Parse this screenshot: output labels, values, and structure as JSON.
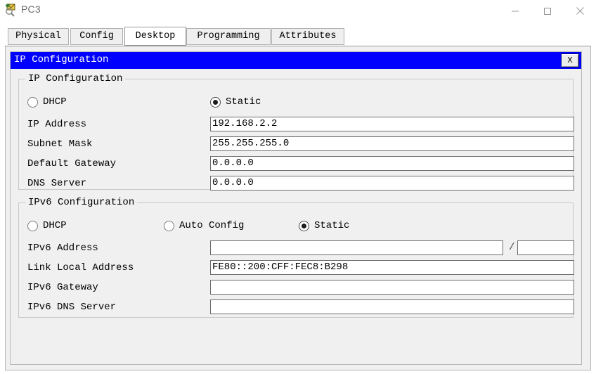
{
  "window": {
    "title": "PC3",
    "icon": "pc-magnifier-icon",
    "controls": {
      "minimize": "minimize-icon",
      "maximize": "maximize-icon",
      "close": "close-icon"
    }
  },
  "tabs": [
    {
      "label": "Physical",
      "active": false
    },
    {
      "label": "Config",
      "active": false
    },
    {
      "label": "Desktop",
      "active": true
    },
    {
      "label": "Programming",
      "active": false
    },
    {
      "label": "Attributes",
      "active": false
    }
  ],
  "internal_window": {
    "title": "IP Configuration",
    "close_label": "X"
  },
  "ipv4": {
    "legend": "IP Configuration",
    "mode_options": [
      {
        "label": "DHCP",
        "selected": false
      },
      {
        "label": "Static",
        "selected": true
      }
    ],
    "fields": [
      {
        "label": "IP Address",
        "value": "192.168.2.2"
      },
      {
        "label": "Subnet Mask",
        "value": "255.255.255.0"
      },
      {
        "label": "Default Gateway",
        "value": "0.0.0.0"
      },
      {
        "label": "DNS Server",
        "value": "0.0.0.0"
      }
    ]
  },
  "ipv6": {
    "legend": "IPv6 Configuration",
    "mode_options": [
      {
        "label": "DHCP",
        "selected": false
      },
      {
        "label": "Auto Config",
        "selected": false
      },
      {
        "label": "Static",
        "selected": true
      }
    ],
    "address": {
      "label": "IPv6 Address",
      "value": "",
      "separator": "/",
      "prefix": ""
    },
    "fields": [
      {
        "label": "Link Local Address",
        "value": "FE80::200:CFF:FEC8:B298"
      },
      {
        "label": "IPv6 Gateway",
        "value": ""
      },
      {
        "label": "IPv6 DNS Server",
        "value": ""
      }
    ]
  },
  "colors": {
    "title_bar_blue": "#0000FF",
    "window_bg": "#F0F0F0",
    "field_bg": "#FFFFFF"
  }
}
